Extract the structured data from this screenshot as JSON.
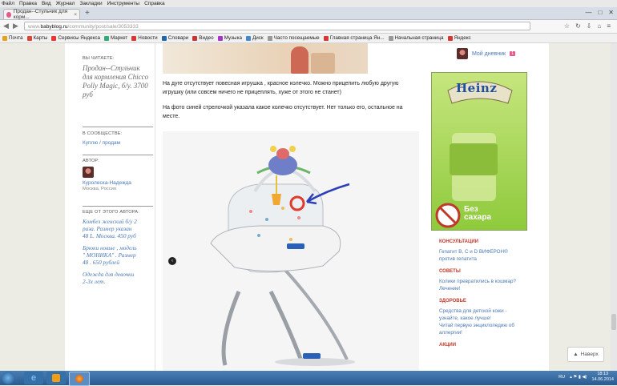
{
  "menubar": [
    "Файл",
    "Правка",
    "Вид",
    "Журнал",
    "Закладки",
    "Инструменты",
    "Справка"
  ],
  "tab": {
    "title": "Продан--Стульчик для корм...",
    "close": "×",
    "new": "+"
  },
  "window": {
    "min": "—",
    "max": "□",
    "close": "✕"
  },
  "url": {
    "prefix": "www.",
    "domain": "babyblog.ru",
    "path": "/community/post/sale/3053333"
  },
  "bookmarks": [
    "Почта",
    "Карты",
    "Сервисы Яндекса",
    "Маркет",
    "Новости",
    "Словари",
    "Видео",
    "Музыка",
    "Диск",
    "Часто посещаемые",
    "Главная страница Ян...",
    "Начальная страница",
    "Яндекс"
  ],
  "sidebar": {
    "reading_cap": "ВЫ ЧИТАЕТЕ:",
    "reading_title": "Продан--Стульчик для кормления Chicco Polly Magic, б/у. 3700 руб",
    "community_cap": "В СООБЩЕСТВЕ:",
    "community_link": "Куплю / продам",
    "author_cap": "АВТОР:",
    "author_name": "Куролеска-Надежда",
    "author_city": "Москва, Россия",
    "more_cap": "ЕЩЕ ОТ ЭТОГО АВТОРА:",
    "more_items": [
      {
        "title": "Комбез женский б/у 2 раза. Размер указан 48 L. Москва. 450 руб"
      },
      {
        "title": "Брюки новые , модель \" МОНИКА\" . Размер 48 . 650 рублей"
      },
      {
        "title": "Одежда для девочки 2-3х лет."
      }
    ]
  },
  "main": {
    "para1": "На дуге отсутствует повесная игрушка , красное колечко. Можно прицепить любую другую игрушку (или совсем ничего не прицеплять, хуже от этого не станет)",
    "para2": "На фото  синей стрелочкой указала какое колечко отсутствует. Нет только его, остальное на месте."
  },
  "right": {
    "diary": "Мой дневник",
    "diary_badge": "1",
    "ad_brand": "Heinz",
    "ad_text": "Без сахара",
    "sections": [
      {
        "cap": "КОНСУЛЬТАЦИИ",
        "links": [
          "Гепатит В, С и D ВИФЕРОН®",
          "против гепатита"
        ]
      },
      {
        "cap": "СОВЕТЫ",
        "links": [
          "Колики превратились в кошмар?",
          "Лечение!"
        ]
      },
      {
        "cap": "ЗДОРОВЬЕ",
        "links": [
          "Средства для детской кожи -",
          "узнайте, какое лучше!",
          "Читай первую энциклопедию об",
          "аллергии!"
        ]
      },
      {
        "cap": "АКЦИИ",
        "links": []
      }
    ]
  },
  "back_button": "Наверх",
  "taskbar": {
    "lang": "RU",
    "time": "18:13",
    "date": "14.06.2014"
  }
}
